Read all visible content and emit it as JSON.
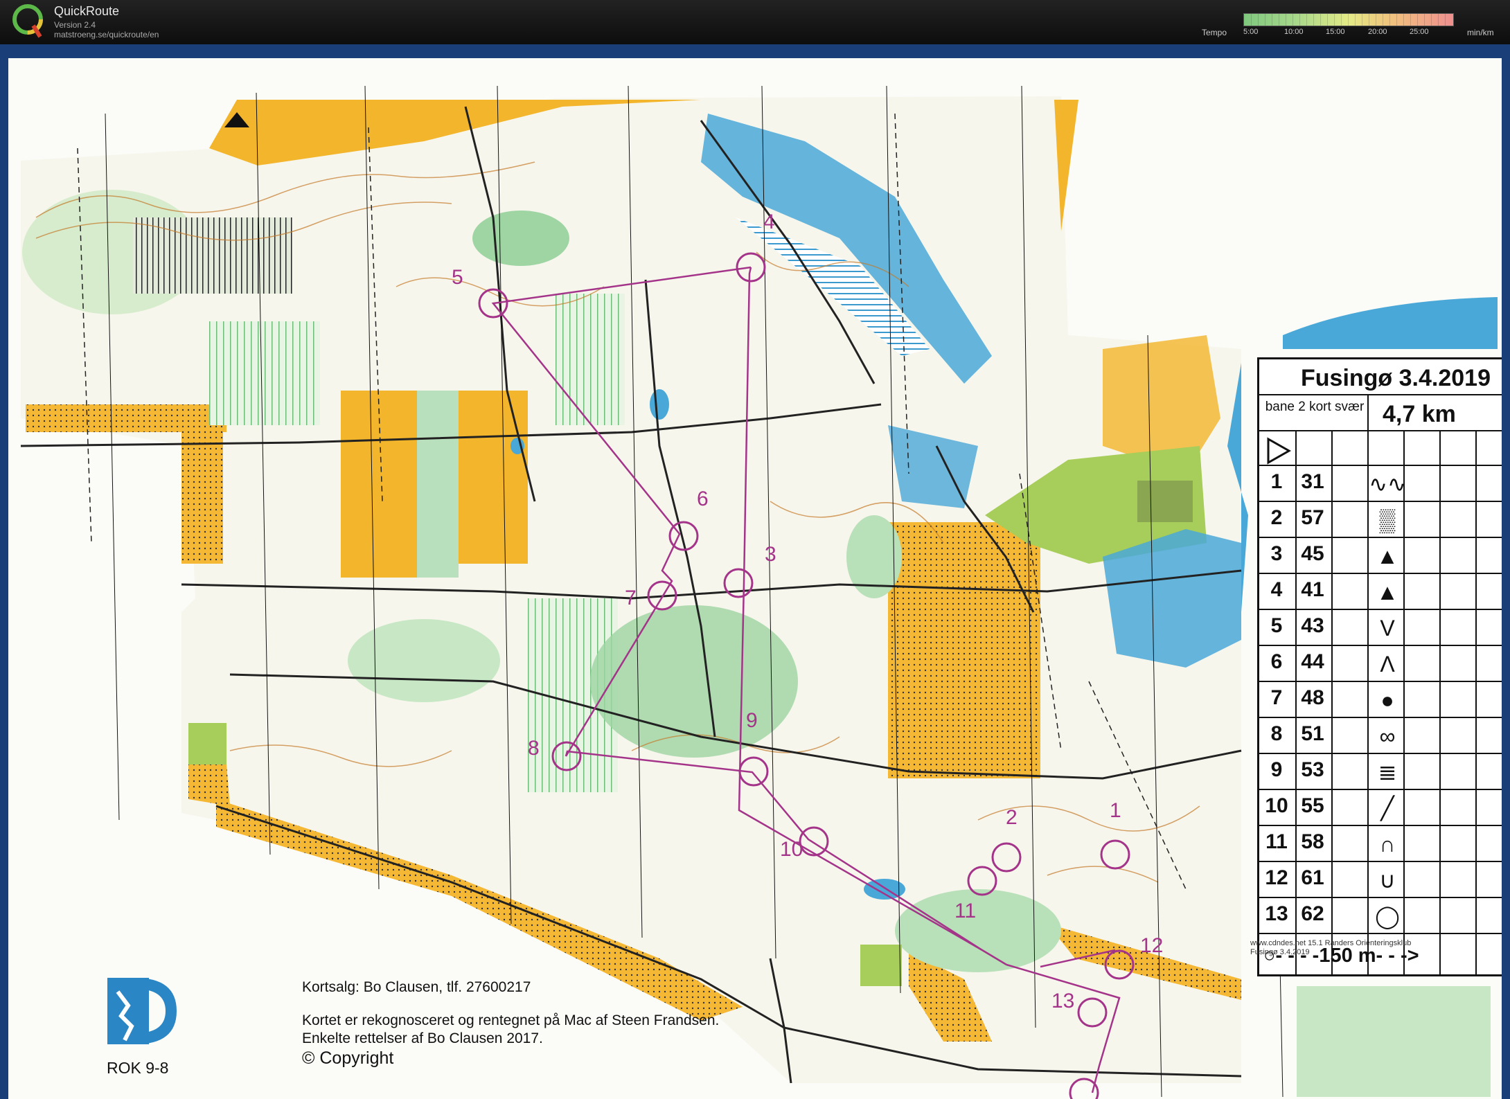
{
  "app": {
    "name": "QuickRoute",
    "version": "Version 2.4",
    "url": "matstroeng.se/quickroute/en",
    "tempo_label": "Tempo",
    "tempo_ticks": [
      "5:00",
      "10:00",
      "15:00",
      "20:00",
      "25:00"
    ],
    "tempo_unit": "min/km"
  },
  "map": {
    "course_title": "Fusingø 3.4.2019",
    "course_name": "bane 2 kort svær",
    "course_length": "4,7 km",
    "scale_text": "○- - - -150 m- - ->",
    "controls": [
      {
        "num": "1",
        "code": "31",
        "symbol": "∿∿"
      },
      {
        "num": "2",
        "code": "57",
        "symbol": "▒"
      },
      {
        "num": "3",
        "code": "45",
        "symbol": "▲"
      },
      {
        "num": "4",
        "code": "41",
        "symbol": "▲"
      },
      {
        "num": "5",
        "code": "43",
        "symbol": "V"
      },
      {
        "num": "6",
        "code": "44",
        "symbol": "Λ"
      },
      {
        "num": "7",
        "code": "48",
        "symbol": "●"
      },
      {
        "num": "8",
        "code": "51",
        "symbol": "∞"
      },
      {
        "num": "9",
        "code": "53",
        "symbol": "≣"
      },
      {
        "num": "10",
        "code": "55",
        "symbol": "╱"
      },
      {
        "num": "11",
        "code": "58",
        "symbol": "∩"
      },
      {
        "num": "12",
        "code": "61",
        "symbol": "∪"
      },
      {
        "num": "13",
        "code": "62",
        "symbol": "◯"
      }
    ],
    "map_labels": [
      "4",
      "5",
      "6",
      "7",
      "3",
      "8",
      "9",
      "10",
      "2",
      "1",
      "11",
      "12",
      "13"
    ],
    "sale": "Kortsalg: Bo Clausen, tlf. 27600217",
    "recon_1": "Kortet er rekognosceret og rentegnet på Mac af Steen Frandsen.",
    "recon_2": "Enkelte rettelser af Bo Clausen 2017.",
    "copyright": "© Copyright",
    "club_code": "ROK 9-8",
    "printer_1": "www.cdndes.net 15.1 Randers Orienteringsklub",
    "printer_2": "Fusingø 3.4.2019"
  },
  "colors": {
    "course_magenta": "#a43489",
    "field_yellow": "#f3b52b",
    "forest_green": "#7fc98a",
    "water_blue": "#4aa8d8",
    "frame_blue": "#1a3f78"
  }
}
